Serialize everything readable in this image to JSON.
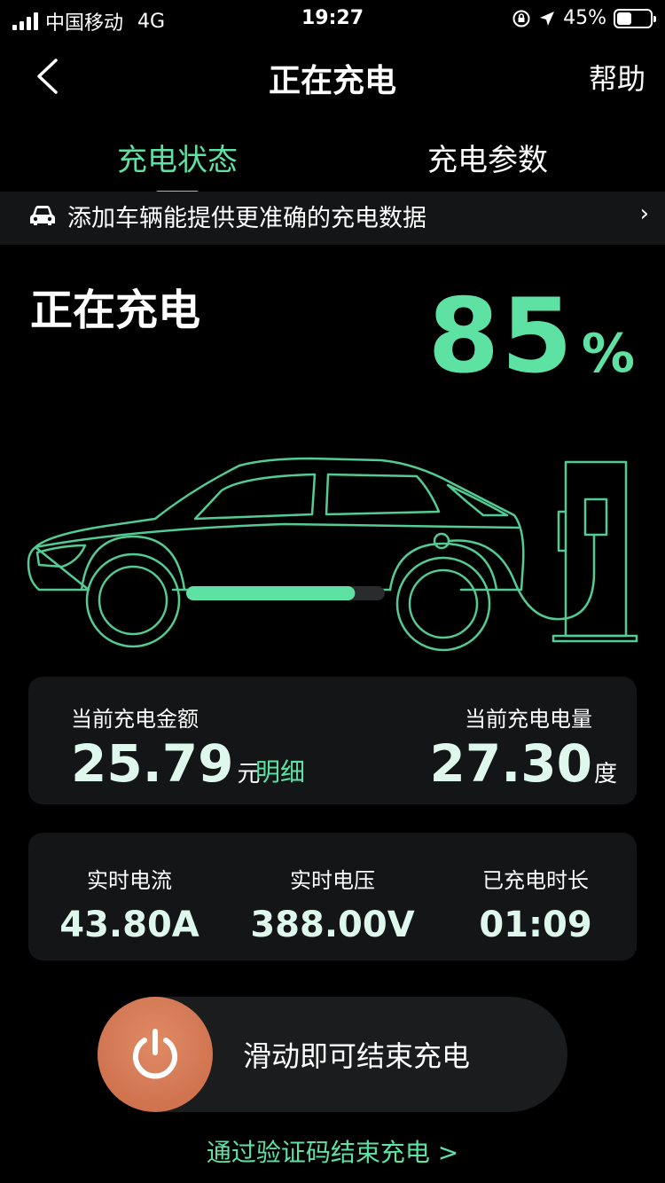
{
  "status_bar": {
    "carrier": "中国移动",
    "network": "4G",
    "time": "19:27",
    "battery": "45%",
    "battery_level": 0.45
  },
  "nav": {
    "title": "正在充电",
    "help": "帮助"
  },
  "tabs": [
    {
      "label": "充电状态",
      "active": true
    },
    {
      "label": "充电参数",
      "active": false
    }
  ],
  "banner": {
    "text": "添加车辆能提供更准确的充电数据",
    "chevron": "›"
  },
  "charging": {
    "status": "正在充电",
    "percent": "85",
    "percent_sign": "%",
    "level": 0.85
  },
  "amount_card": {
    "amount_label": "当前充电金额",
    "amount_value": "25.79",
    "amount_unit": "元",
    "detail_link": "明细",
    "energy_label": "当前充电电量",
    "energy_value": "27.30",
    "energy_unit": "度"
  },
  "stats": [
    {
      "label": "实时电流",
      "value": "43.80A"
    },
    {
      "label": "实时电压",
      "value": "388.00V"
    },
    {
      "label": "已充电时长",
      "value": "01:09"
    }
  ],
  "slider": {
    "label": "滑动即可结束充电",
    "icon": "power-icon"
  },
  "verify_link": "通过验证码结束充电 >",
  "colors": {
    "accent": "#5ee2a4",
    "card": "#141516",
    "knob": "#d4784f"
  }
}
